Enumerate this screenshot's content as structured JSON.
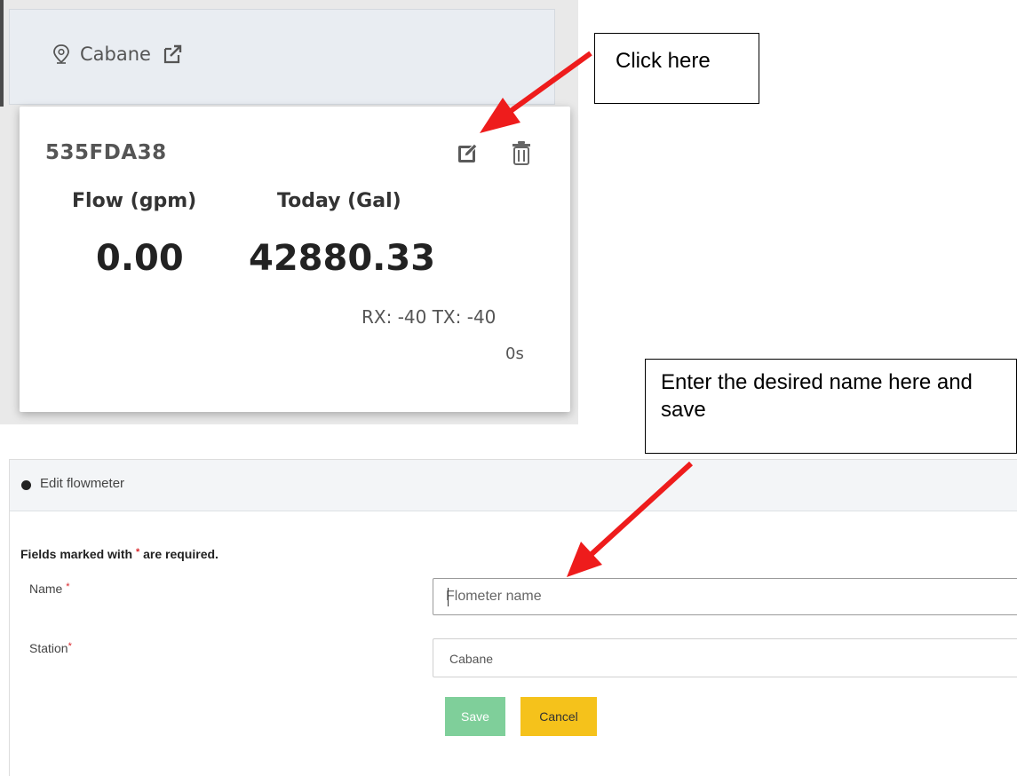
{
  "station_header": {
    "station_name": "Cabane",
    "icons": {
      "pin": "map-pin-icon",
      "open": "external-link-icon"
    }
  },
  "flow_card": {
    "device_id": "535FDA38",
    "flow_label": "Flow (gpm)",
    "flow_value": "0.00",
    "today_label": "Today (Gal)",
    "today_value": "42880.33",
    "signal": "RX: -40 TX: -40",
    "age": "0s",
    "icons": {
      "edit": "edit-icon",
      "delete": "trash-icon"
    }
  },
  "callouts": {
    "click": "Click here",
    "enter": "Enter the desired name here and save"
  },
  "edit_form": {
    "title": "Edit flowmeter",
    "required_prefix": "Fields marked with",
    "required_mark": "*",
    "required_suffix": "are required.",
    "name_label": "Name",
    "name_placeholder": "Flometer name",
    "station_label": "Station",
    "station_value": "Cabane",
    "save_label": "Save",
    "cancel_label": "Cancel"
  },
  "colors": {
    "arrow": "#ee1c1c",
    "save_button": "#7fcf9a",
    "cancel_button": "#f5c21b",
    "required": "#d9262b"
  }
}
